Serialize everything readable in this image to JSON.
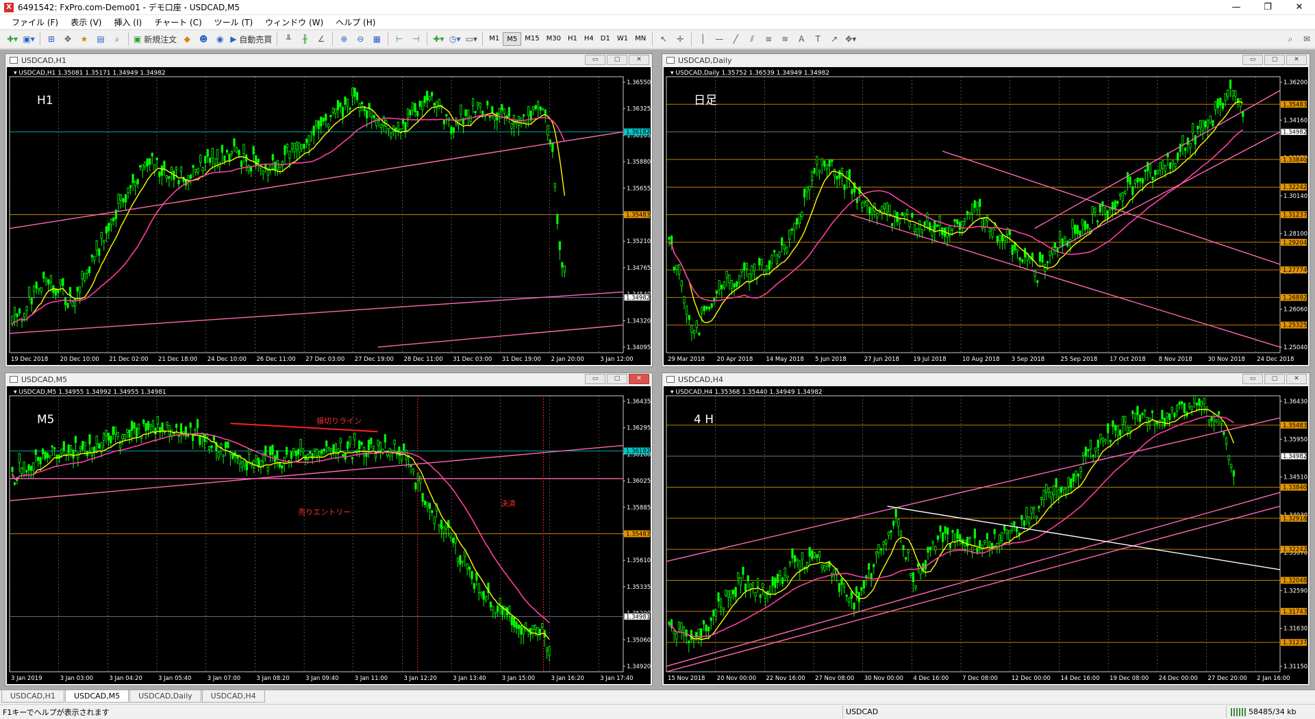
{
  "window": {
    "title": "6491542: FxPro.com-Demo01 - デモ口座 - USDCAD,M5",
    "minimize": "—",
    "maximize": "❐",
    "close": "✕"
  },
  "menu": [
    "ファイル (F)",
    "表示 (V)",
    "挿入 (I)",
    "チャート (C)",
    "ツール (T)",
    "ウィンドウ (W)",
    "ヘルプ (H)"
  ],
  "toolbar": {
    "new_order": "新規注文",
    "auto_trade": "自動売買",
    "timeframes": [
      "M1",
      "M5",
      "M15",
      "M30",
      "H1",
      "H4",
      "D1",
      "W1",
      "MN"
    ],
    "active_timeframe": "M5"
  },
  "charts": [
    {
      "id": "h1",
      "title": "USDCAD,H1",
      "info": "USDCAD,H1  1.35081 1.35171 1.34949 1.34982",
      "label": "H1",
      "prices": [
        "1.36550",
        "1.36325",
        "1.36105",
        "1.35880",
        "1.35655",
        "1.35435",
        "1.35210",
        "1.34765",
        "1.34540",
        "1.34320",
        "1.34095"
      ],
      "highlights": [
        {
          "text": "1.36182",
          "color": "#00c8c8"
        },
        {
          "text": "1.35483",
          "color": "#e69500"
        },
        {
          "text": "1.34982",
          "color": "#ffffff"
        }
      ],
      "dates": [
        "19 Dec 2018",
        "20 Dec 10:00",
        "21 Dec 02:00",
        "21 Dec 18:00",
        "24 Dec 10:00",
        "26 Dec 11:00",
        "27 Dec 03:00",
        "27 Dec 19:00",
        "28 Dec 11:00",
        "31 Dec 03:00",
        "31 Dec 19:00",
        "2 Jan 20:00",
        "3 Jan 12:00"
      ]
    },
    {
      "id": "daily",
      "title": "USDCAD,Daily",
      "info": "USDCAD,Daily  1.35752 1.36539 1.34949 1.34982",
      "label": "日足",
      "prices": [
        "1.36200",
        "1.34160",
        "1.33170",
        "1.30140",
        "1.28100",
        "1.27080",
        "1.26060",
        "1.25040"
      ],
      "highlights": [
        {
          "text": "1.35483",
          "color": "#e69500"
        },
        {
          "text": "1.34982",
          "color": "#ffffff"
        },
        {
          "text": "1.33840",
          "color": "#e69500"
        },
        {
          "text": "1.32242",
          "color": "#e69500"
        },
        {
          "text": "1.31237",
          "color": "#e69500"
        },
        {
          "text": "1.29204",
          "color": "#e69500"
        },
        {
          "text": "1.27774",
          "color": "#e69500"
        },
        {
          "text": "1.26892",
          "color": "#e69500"
        },
        {
          "text": "1.25325",
          "color": "#e69500"
        }
      ],
      "dates": [
        "29 Mar 2018",
        "20 Apr 2018",
        "14 May 2018",
        "5 Jun 2018",
        "27 Jun 2018",
        "19 Jul 2018",
        "10 Aug 2018",
        "3 Sep 2018",
        "25 Sep 2018",
        "17 Oct 2018",
        "8 Nov 2018",
        "30 Nov 2018",
        "24 Dec 2018"
      ]
    },
    {
      "id": "m5",
      "title": "USDCAD,M5",
      "info": "USDCAD,M5  1.34955 1.34992 1.34955 1.34981",
      "label": "M5",
      "prices": [
        "1.36435",
        "1.36295",
        "1.36160",
        "1.36025",
        "1.35885",
        "1.35745",
        "1.35610",
        "1.35335",
        "1.35200",
        "1.35060",
        "1.34920"
      ],
      "highlights": [
        {
          "text": "1.36182",
          "color": "#00c8c8"
        },
        {
          "text": "1.35483",
          "color": "#e69500"
        },
        {
          "text": "1.34981",
          "color": "#ffffff"
        }
      ],
      "annotations": {
        "stop": "損切りライン",
        "entry": "売りエントリー",
        "exit": "決済"
      },
      "dates": [
        "3 Jan 2019",
        "3 Jan 03:00",
        "3 Jan 04:20",
        "3 Jan 05:40",
        "3 Jan 07:00",
        "3 Jan 08:20",
        "3 Jan 09:40",
        "3 Jan 11:00",
        "3 Jan 12:20",
        "3 Jan 13:40",
        "3 Jan 15:00",
        "3 Jan 16:20",
        "3 Jan 17:40"
      ]
    },
    {
      "id": "h4",
      "title": "USDCAD,H4",
      "info": "USDCAD,H4  1.35368 1.35440 1.34949 1.34982",
      "label": "4 H",
      "prices": [
        "1.36430",
        "1.35950",
        "1.34510",
        "1.34030",
        "1.33070",
        "1.32590",
        "1.31630",
        "1.31150"
      ],
      "highlights": [
        {
          "text": "1.35483",
          "color": "#e69500"
        },
        {
          "text": "1.34982",
          "color": "#ffffff"
        },
        {
          "text": "1.33840",
          "color": "#e69500"
        },
        {
          "text": "1.32918",
          "color": "#e69500"
        },
        {
          "text": "1.32242",
          "color": "#e69500"
        },
        {
          "text": "1.32048",
          "color": "#e69500"
        },
        {
          "text": "1.31743",
          "color": "#e69500"
        },
        {
          "text": "1.31237",
          "color": "#e69500"
        }
      ],
      "dates": [
        "15 Nov 2018",
        "20 Nov 00:00",
        "22 Nov 16:00",
        "27 Nov 08:00",
        "30 Nov 00:00",
        "4 Dec 16:00",
        "7 Dec 08:00",
        "12 Dec 00:00",
        "14 Dec 16:00",
        "19 Dec 08:00",
        "24 Dec 00:00",
        "27 Dec 20:00",
        "2 Jan 16:00"
      ]
    }
  ],
  "tabs": [
    "USDCAD,H1",
    "USDCAD,M5",
    "USDCAD,Daily",
    "USDCAD,H4"
  ],
  "active_tab": "USDCAD,M5",
  "status": {
    "help": "F1キーでヘルプが表示されます",
    "symbol": "USDCAD",
    "traffic": "58485/34 kb"
  }
}
